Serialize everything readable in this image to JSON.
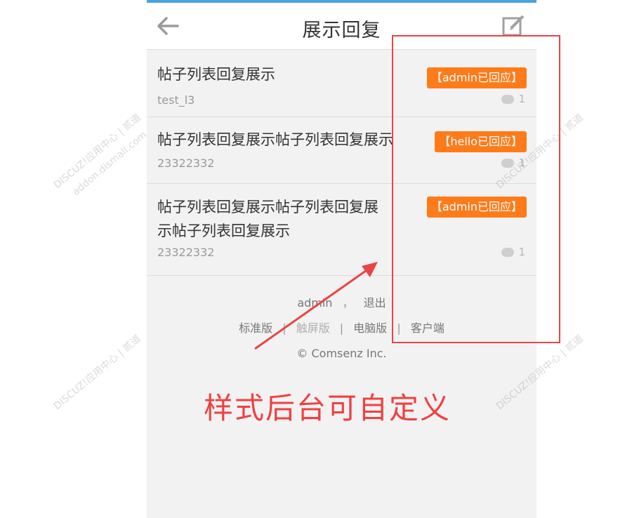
{
  "header": {
    "title": "展示回复",
    "back_icon": "arrow-left-icon",
    "compose_icon": "compose-icon"
  },
  "threads": [
    {
      "title": "帖子列表回复展示",
      "author": "test_l3",
      "badge": "【admin已回应】",
      "replies": "1"
    },
    {
      "title": "帖子列表回复展示帖子列表回复展示",
      "author": "23322332",
      "badge": "【hello已回应】",
      "replies": "1"
    },
    {
      "title_line1": "帖子列表回复展示帖子列表回复展",
      "title_line2": "示帖子列表回复展示",
      "author": "23322332",
      "badge": "【admin已回应】",
      "replies": "1"
    }
  ],
  "footer": {
    "user": "admin",
    "comma": "，",
    "logout": "退出",
    "links": [
      "标准版",
      "触屏版",
      "电脑版",
      "客户端"
    ],
    "separator": "|",
    "copyright": "© Comsenz Inc."
  },
  "annotation": {
    "caption": "样式后台可自定义",
    "color": "#ef4141"
  },
  "watermark": {
    "text": "DISCUZ!应用中心 | 贰道",
    "subtext": "addon.dismall.com"
  },
  "colors": {
    "badge": "#fe7b1a",
    "top_line": "#4aa3df"
  }
}
